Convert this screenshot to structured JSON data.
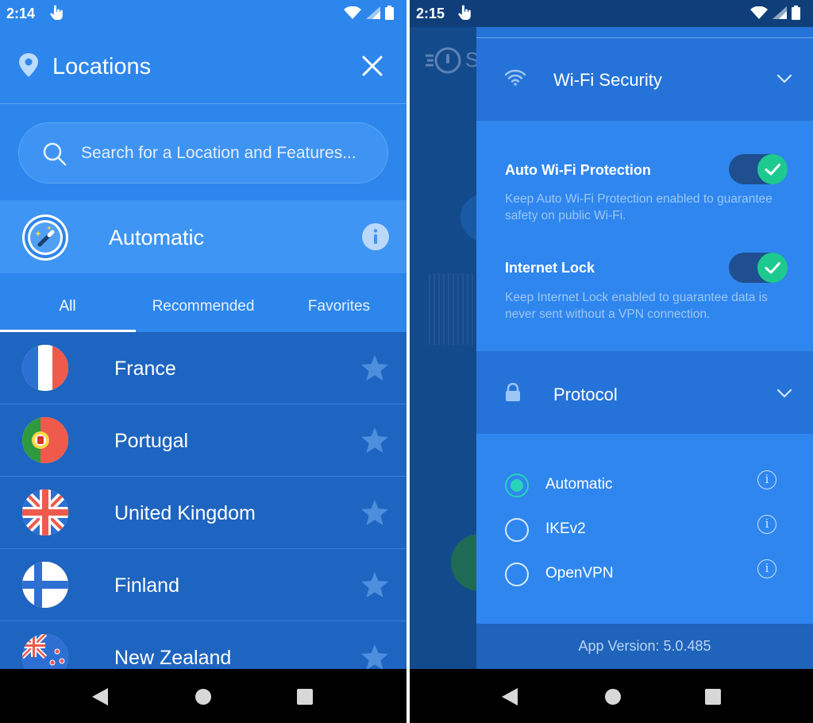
{
  "left_screen": {
    "status_bar": {
      "time": "2:14"
    },
    "header": {
      "title": "Locations"
    },
    "search": {
      "placeholder": "Search for a Location and Features..."
    },
    "automatic_row": {
      "label": "Automatic"
    },
    "tabs": [
      {
        "label": "All",
        "active": true
      },
      {
        "label": "Recommended",
        "active": false
      },
      {
        "label": "Favorites",
        "active": false
      }
    ],
    "countries": [
      {
        "name": "France",
        "flag": "france"
      },
      {
        "name": "Portugal",
        "flag": "portugal"
      },
      {
        "name": "United Kingdom",
        "flag": "united-kingdom"
      },
      {
        "name": "Finland",
        "flag": "finland"
      },
      {
        "name": "New Zealand",
        "flag": "new-zealand"
      }
    ]
  },
  "right_screen": {
    "status_bar": {
      "time": "2:15"
    },
    "background_app": {
      "partial_title": "S"
    },
    "wifi_section": {
      "title": "Wi-Fi Security",
      "auto_wifi": {
        "label": "Auto Wi-Fi Protection",
        "description": "Keep Auto Wi-Fi Protection enabled to guarantee safety on public Wi-Fi.",
        "enabled": true
      },
      "internet_lock": {
        "label": "Internet Lock",
        "description": "Keep Internet Lock enabled to guarantee data is never sent without a VPN connection.",
        "enabled": true
      }
    },
    "protocol_section": {
      "title": "Protocol",
      "options": [
        {
          "label": "Automatic",
          "selected": true
        },
        {
          "label": "IKEv2",
          "selected": false
        },
        {
          "label": "OpenVPN",
          "selected": false
        }
      ]
    },
    "footer": {
      "version": "App Version: 5.0.485"
    }
  },
  "colors": {
    "header_blue": "#2d86ec",
    "list_blue": "#1e64c1",
    "accent_green": "#1ec98f",
    "radio_teal": "#27d3b9"
  },
  "icons": {
    "status": [
      "touch-hand-icon",
      "wifi-signal-icon",
      "cell-signal-icon",
      "battery-icon"
    ],
    "nav": [
      "back-icon",
      "home-icon",
      "recents-icon"
    ]
  }
}
